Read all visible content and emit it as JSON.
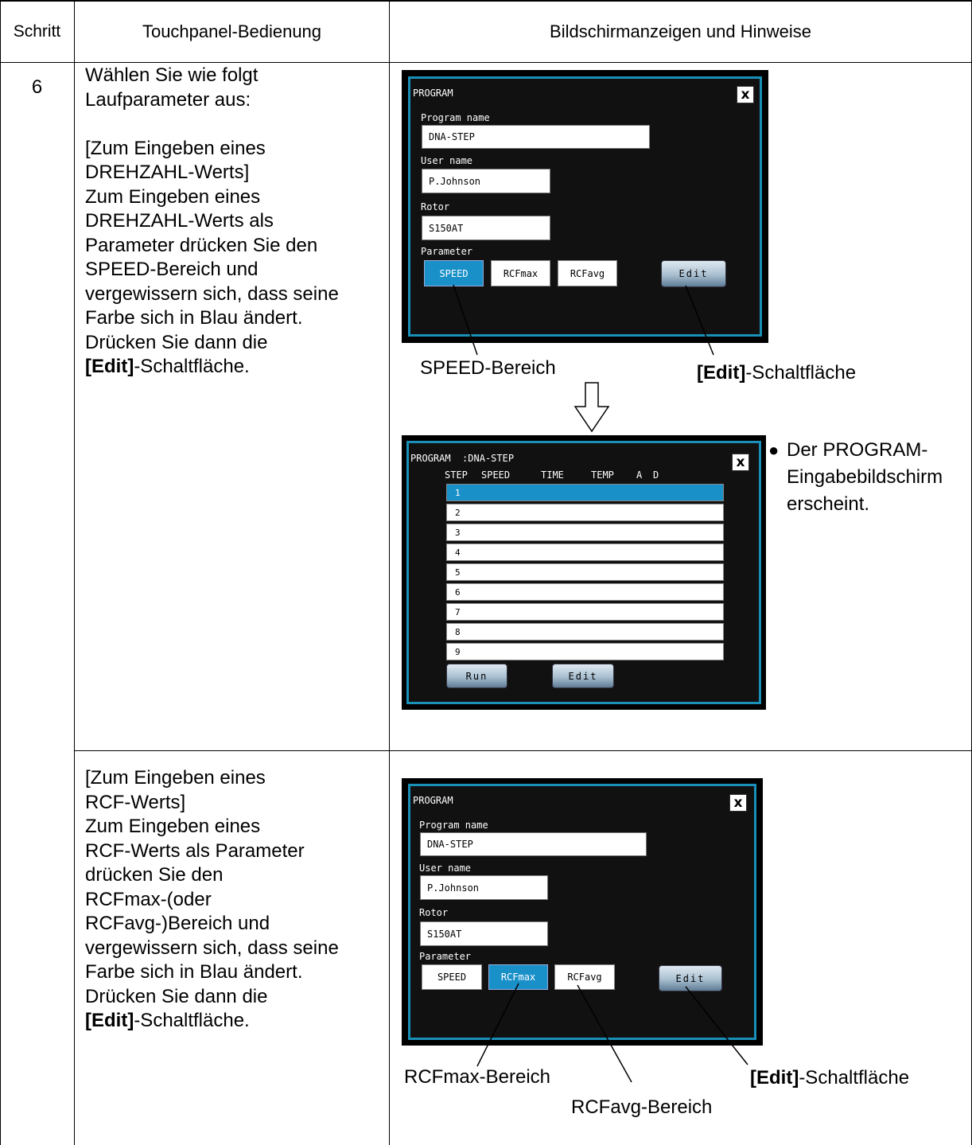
{
  "header": {
    "col1": "Schritt",
    "col2": "Touchpanel-Bedienung",
    "col3": "Bildschirmanzeigen und Hinweise"
  },
  "step": {
    "number": "6"
  },
  "instructions_speed": [
    "Wählen Sie wie folgt",
    "Laufparameter aus:",
    "",
    "[Zum Eingeben eines",
    "DREHZAHL-Werts]",
    "Zum Eingeben eines",
    "DREHZAHL-Werts als",
    "Parameter drücken Sie den",
    "SPEED-Bereich und",
    "vergewissern sich, dass seine",
    "Farbe sich in Blau ändert.",
    "Drücken Sie dann die"
  ],
  "edit_word": "[Edit]",
  "edit_suffix": "-Schaltfläche.",
  "instructions_rcf": [
    "[Zum Eingeben eines",
    "RCF-Werts]",
    "Zum Eingeben eines",
    "RCF-Werts als Parameter",
    "drücken Sie den",
    "RCFmax-(oder",
    "RCFavg-)Bereich und",
    "vergewissern sich, dass seine",
    "Farbe sich in Blau ändert.",
    "Drücken Sie dann die"
  ],
  "program_screen": {
    "title": "PROGRAM",
    "close": "x",
    "program_name_label": "Program name",
    "program_name_value": "DNA-STEP",
    "user_name_label": "User name",
    "user_name_value": "P.Johnson",
    "rotor_label": "Rotor",
    "rotor_value": "S150AT",
    "parameter_label": "Parameter",
    "speed_btn": "SPEED",
    "rcfmax_btn": "RCFmax",
    "rcfavg_btn": "RCFavg",
    "edit_btn": "Edit"
  },
  "step_screen": {
    "title": "PROGRAM",
    "program_sep": ":",
    "program_name": "DNA-STEP",
    "close": "x",
    "columns": [
      "STEP",
      "SPEED",
      "TIME",
      "TEMP",
      "A",
      "D"
    ],
    "rows": [
      "1",
      "2",
      "3",
      "4",
      "5",
      "6",
      "7",
      "8",
      "9"
    ],
    "run_btn": "Run",
    "edit_btn": "Edit"
  },
  "callouts": {
    "speed_area": "SPEED-Bereich",
    "edit_button_suffix": "-Schaltfläche",
    "rcfmax_area": "RCFmax-Bereich",
    "rcfavg_area": "RCFavg-Bereich"
  },
  "note": {
    "bullet": "●",
    "lines": [
      "Der PROGRAM-",
      "Eingabebildschirm",
      "erscheint."
    ]
  },
  "arrow_icon": "hollow-down-arrow-icon"
}
